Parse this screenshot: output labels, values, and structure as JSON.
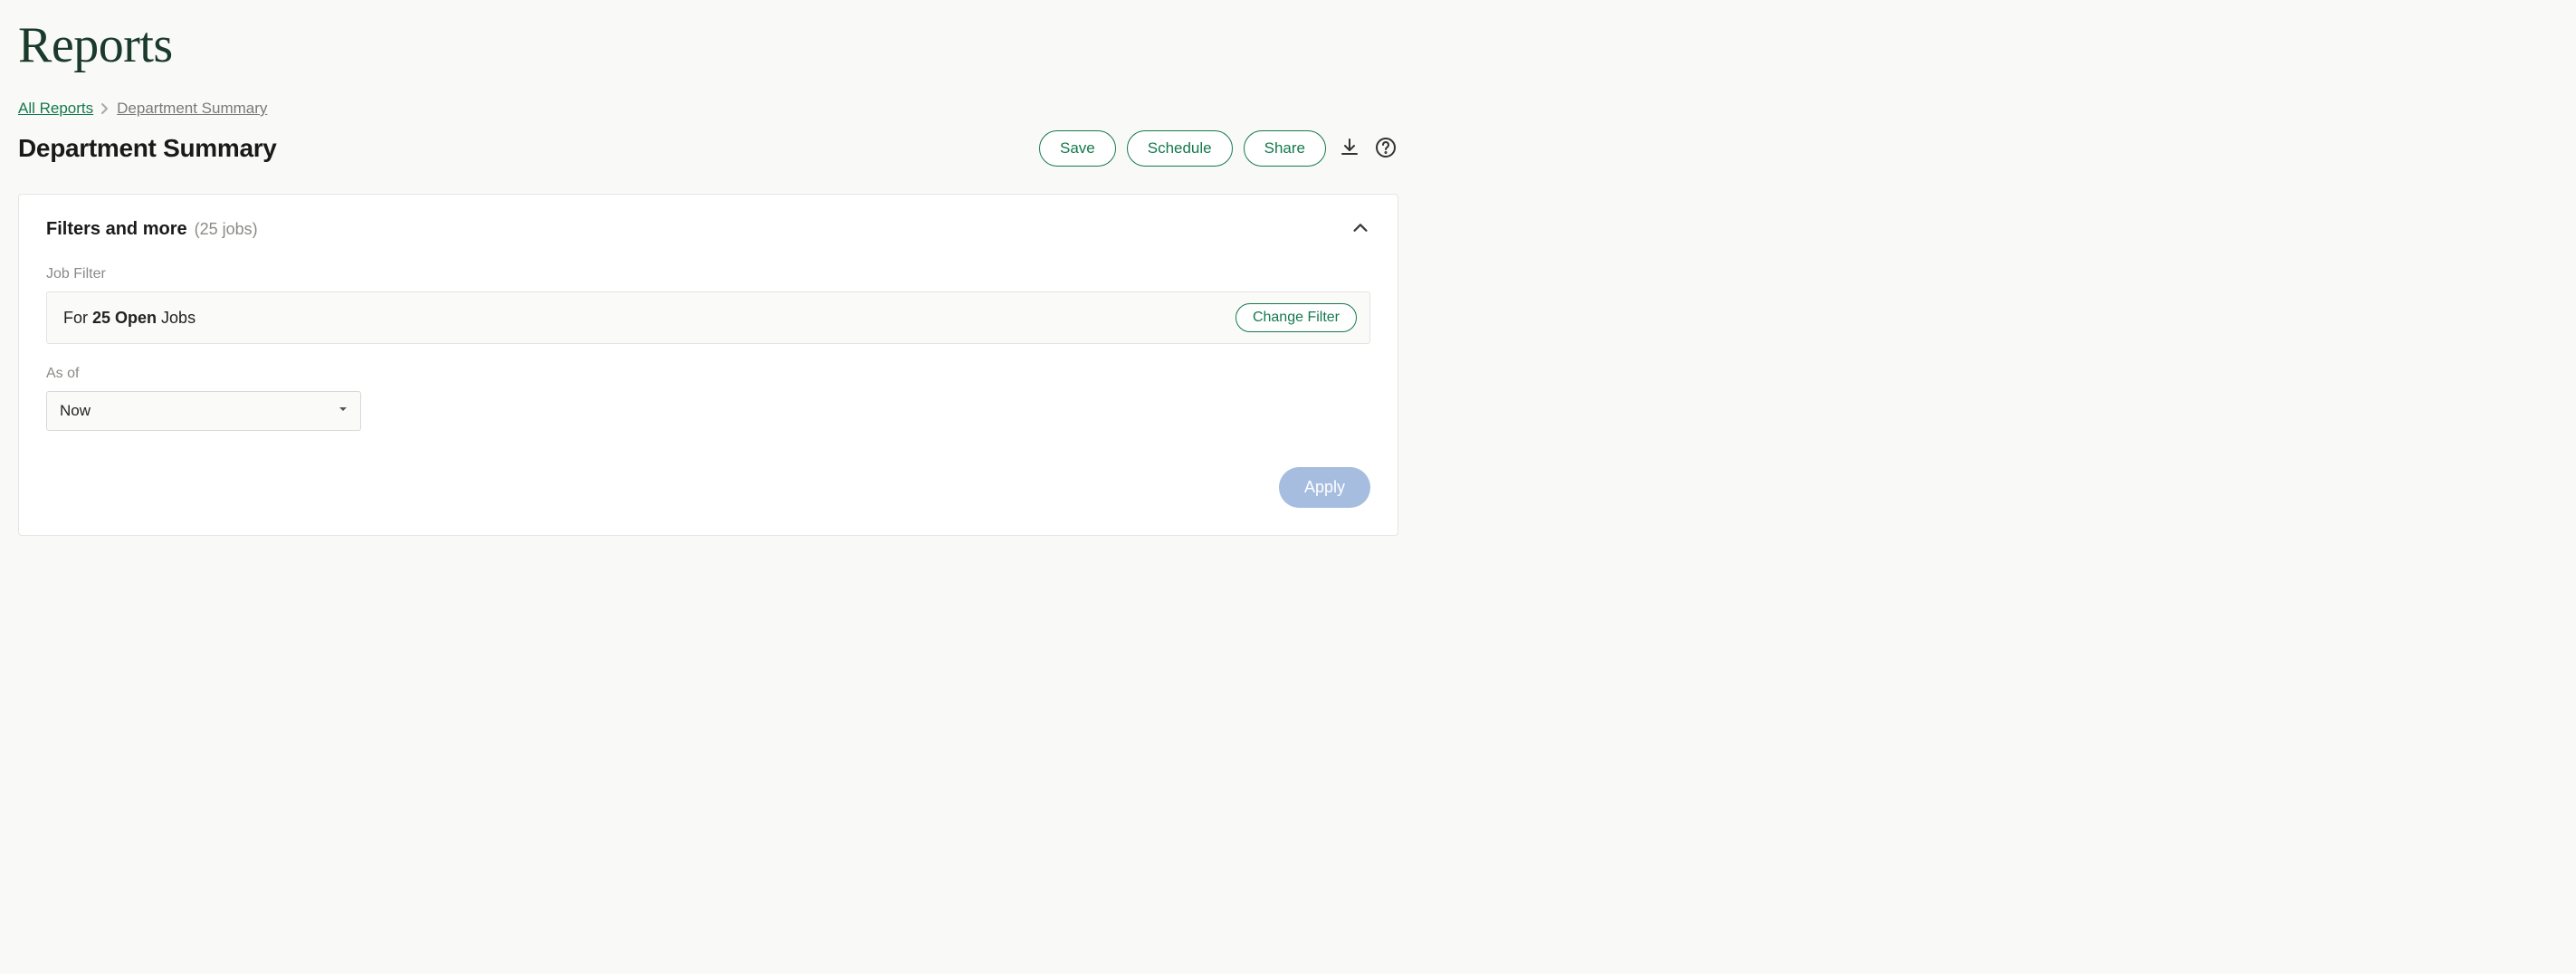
{
  "page": {
    "title": "Reports"
  },
  "breadcrumb": {
    "root": "All Reports",
    "current": "Department Summary"
  },
  "report": {
    "title": "Department Summary"
  },
  "actions": {
    "save": "Save",
    "schedule": "Schedule",
    "share": "Share"
  },
  "panel": {
    "title": "Filters and more",
    "count_text": "(25 jobs)"
  },
  "job_filter": {
    "label": "Job Filter",
    "prefix": "For ",
    "bold": "25 Open",
    "suffix": " Jobs",
    "change": "Change Filter"
  },
  "as_of": {
    "label": "As of",
    "value": "Now"
  },
  "apply": {
    "label": "Apply"
  }
}
